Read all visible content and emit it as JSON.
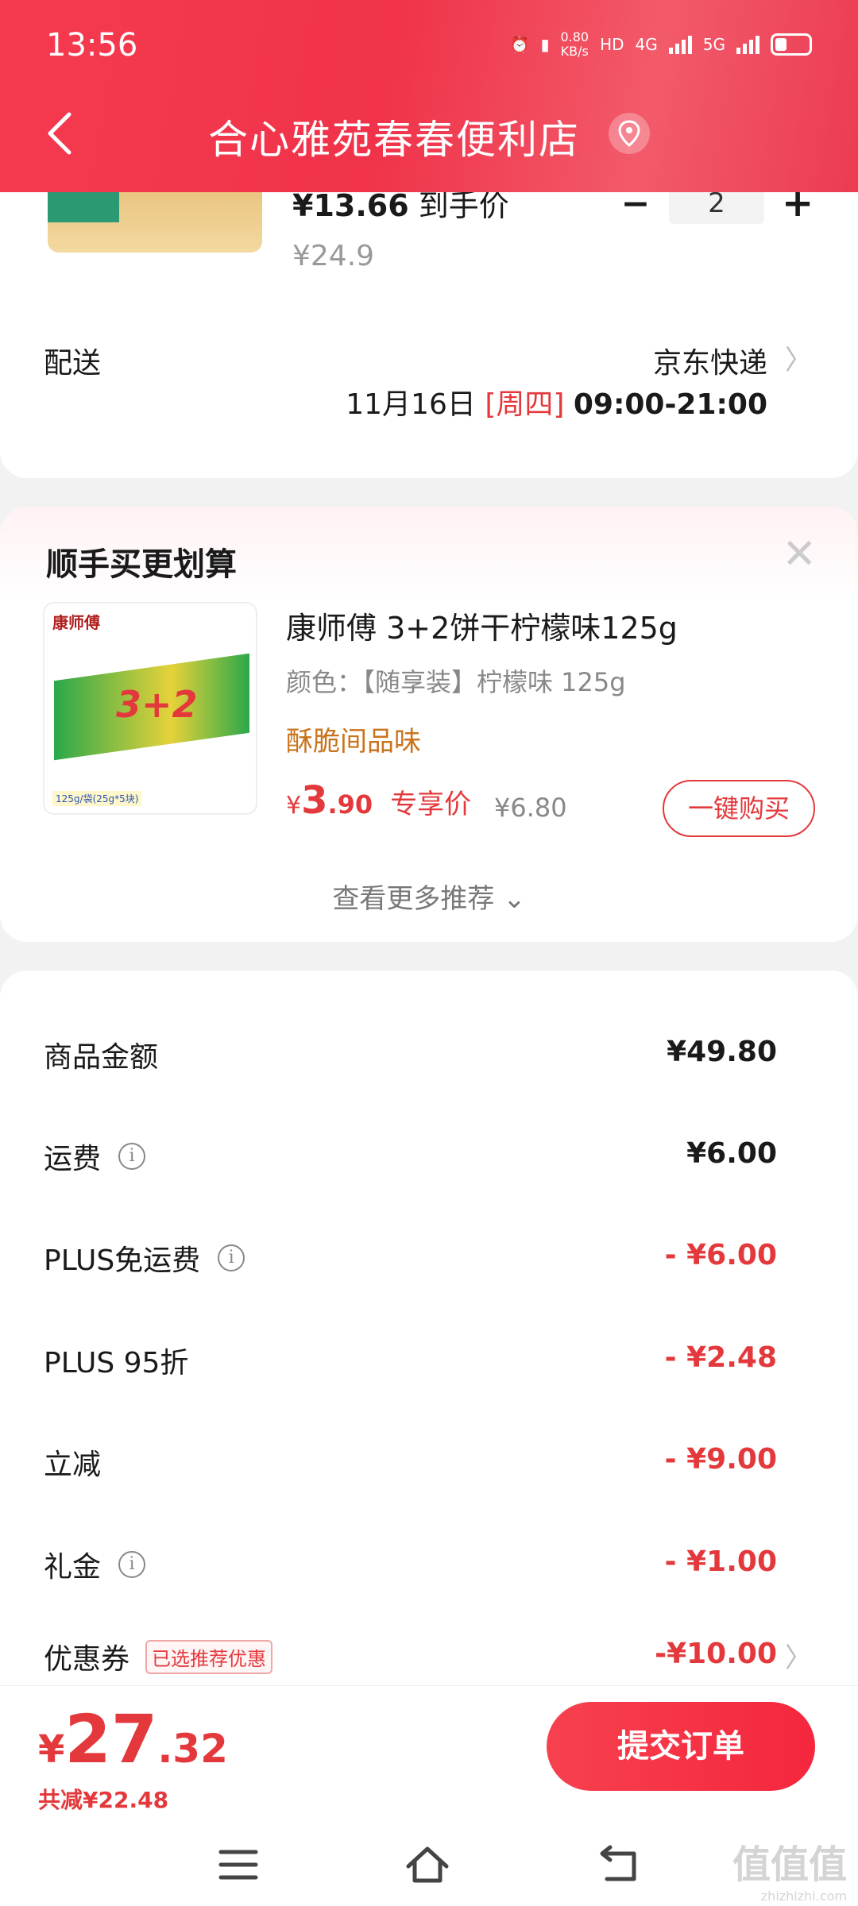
{
  "status_bar": {
    "time": "13:56",
    "speed_top": "0.80",
    "speed_unit": "KB/s",
    "hd": "HD",
    "net1": "4G",
    "net2": "5G"
  },
  "header": {
    "title": "合心雅苑春春便利店"
  },
  "order_item": {
    "price_hand": "¥13.66",
    "price_hand_label": "到手价",
    "quantity": "2",
    "original_price": "¥24.9"
  },
  "delivery": {
    "label": "配送",
    "method": "京东快递",
    "date": "11月16日",
    "weekday": "[周四]",
    "time": "09:00-21:00"
  },
  "recommend": {
    "title": "顺手买更划算",
    "product_name": "康师傅 3+2饼干柠檬味125g",
    "spec": "颜色：【随享装】柠檬味 125g",
    "tag": "酥脆间品味",
    "price_currency": "¥",
    "price_int": "3",
    "price_dec": ".90",
    "price_label": "专享价",
    "original_price": "¥6.80",
    "buy_button": "一键购买",
    "more": "查看更多推荐",
    "pkg_brand": "康师傅",
    "pkg_number": "3+2",
    "pkg_weight": "125g/袋(25g*5块)"
  },
  "summary": {
    "rows": [
      {
        "label": "商品金额",
        "value": "¥49.80"
      },
      {
        "label": "运费",
        "value": "¥6.00"
      },
      {
        "label": "PLUS免运费",
        "value": "- ¥6.00"
      },
      {
        "label": "PLUS 95折",
        "value": "- ¥2.48"
      },
      {
        "label": "立减",
        "value": "- ¥9.00"
      },
      {
        "label": "礼金",
        "value": "- ¥1.00"
      },
      {
        "label": "优惠券",
        "value": "-¥10.00",
        "tag": "已选推荐优惠"
      }
    ]
  },
  "bottom": {
    "total_currency": "¥",
    "total_int": "27",
    "total_dec": ".32",
    "saved": "共减¥22.48",
    "submit": "提交订单"
  },
  "watermark": {
    "text": "值值值",
    "site": "zhizhizhi.com"
  },
  "colors": {
    "brand_red": "#e4393c",
    "header_red": "#f0334a",
    "tag_orange": "#c9731c"
  }
}
